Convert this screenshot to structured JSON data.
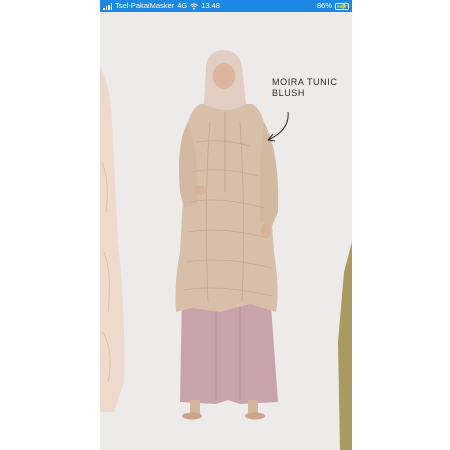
{
  "status_bar": {
    "carrier": "Tsel-PakaiMasker",
    "network": "4G",
    "time": "13.48",
    "battery": "86%",
    "battery_level": 0.86,
    "background_color": "#1e88e5"
  },
  "product": {
    "name_line1": "MOIRA TUNIC",
    "name_line2": "BLUSH"
  },
  "colors": {
    "tunic": "#d8bfa9",
    "skirt": "#c9a5ab",
    "hijab": "#e3cfc4",
    "background": "#ecebe9"
  },
  "icons": [
    "signal-icon",
    "wifi-icon",
    "battery-icon",
    "arrow-icon"
  ]
}
